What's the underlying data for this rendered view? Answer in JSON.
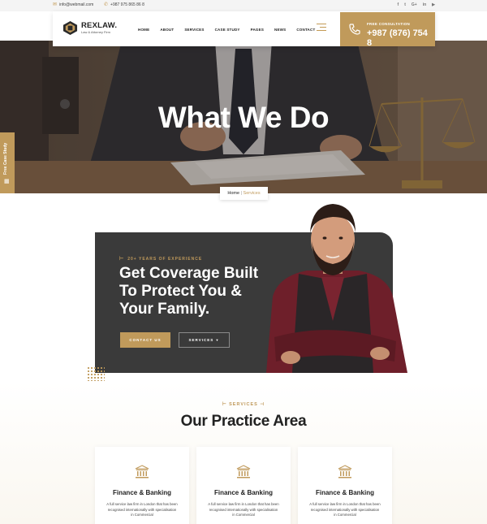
{
  "topbar": {
    "email": "info@webmail.com",
    "phone": "+987 975 865 86 8",
    "socials": [
      {
        "icon": "facebook-icon",
        "glyph": "f"
      },
      {
        "icon": "twitter-icon",
        "glyph": "t"
      },
      {
        "icon": "google-plus-icon",
        "glyph": "G+"
      },
      {
        "icon": "linkedin-icon",
        "glyph": "in"
      },
      {
        "icon": "youtube-icon",
        "glyph": "▶"
      }
    ]
  },
  "header": {
    "logo_name": "REXLAW.",
    "logo_tagline": "Law & Attorney Firm",
    "nav": [
      "HOME",
      "ABOUT",
      "SERVICES",
      "CASE STUDY",
      "PAGES",
      "NEWS",
      "CONTACT"
    ],
    "consult_label": "FREE CONSULTATION",
    "consult_phone": "+987 (876) 754 8"
  },
  "hero": {
    "title": "What We Do",
    "side_tab": "Free Case Study",
    "breadcrumb": {
      "home": "Home",
      "separator": "|",
      "current": "Services"
    }
  },
  "promo": {
    "experience": "20+ YEARS OF EXPERIENCE",
    "heading": "Get Coverage Built To Protect You & Your Family.",
    "contact_btn": "CONTACT US",
    "services_btn": "SERVICES"
  },
  "practice": {
    "subtitle": "SERVICES",
    "title": "Our Practice Area",
    "cards": [
      {
        "title": "Finance & Banking",
        "desc": "A full service law firm in London that has been recognised internationally with specialisation in Commercial"
      },
      {
        "title": "Finance & Banking",
        "desc": "A full service law firm in London that has been recognised internationally with specialisation in Commercial"
      },
      {
        "title": "Finance & Banking",
        "desc": "A full service law firm in London that has been recognised internationally with specialisation in Commercial"
      }
    ]
  },
  "colors": {
    "accent": "#c09a5b",
    "dark": "#3a3a3a",
    "text": "#222222"
  }
}
